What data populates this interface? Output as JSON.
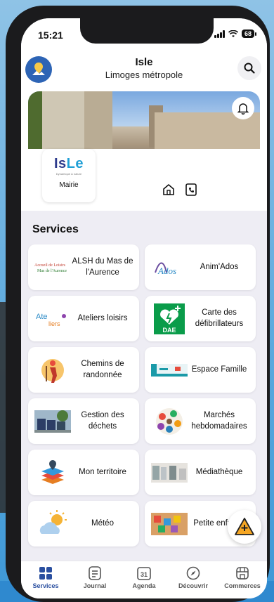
{
  "status_bar": {
    "time": "15:21",
    "battery": "68"
  },
  "header": {
    "title": "Isle",
    "subtitle": "Limoges métropole"
  },
  "mairie": {
    "logo_text_a": "Is",
    "logo_text_b": "Le",
    "tagline": "Dynamique & nature",
    "label": "Mairie"
  },
  "section_title": "Services",
  "services": [
    {
      "label": "ALSH du Mas de l'Aurence",
      "icon": "alsh-logo"
    },
    {
      "label": "Anim'Ados",
      "icon": "animados-logo"
    },
    {
      "label": "Ateliers loisirs",
      "icon": "ateliers-logo"
    },
    {
      "label": "Carte des défibrillateurs",
      "icon": "dae-logo"
    },
    {
      "label": "Chemins de randonnée",
      "icon": "hiker-icon"
    },
    {
      "label": "Espace Famille",
      "icon": "famille-screenshot"
    },
    {
      "label": "Gestion des déchets",
      "icon": "bins-photo"
    },
    {
      "label": "Marchés hebdomadaires",
      "icon": "market-icon"
    },
    {
      "label": "Mon territoire",
      "icon": "map-layers-icon"
    },
    {
      "label": "Médiathèque",
      "icon": "library-photo"
    },
    {
      "label": "Météo",
      "icon": "weather-icon"
    },
    {
      "label": "Petite enfance",
      "icon": "toys-photo"
    }
  ],
  "dae_text": "DAE",
  "tabs": [
    {
      "label": "Services",
      "icon": "grid-icon",
      "active": true
    },
    {
      "label": "Journal",
      "icon": "newspaper-icon"
    },
    {
      "label": "Agenda",
      "icon": "calendar-icon",
      "day": "31"
    },
    {
      "label": "Découvrir",
      "icon": "compass-icon"
    },
    {
      "label": "Commerces",
      "icon": "shop-icon"
    }
  ],
  "colors": {
    "accent": "#2a4fa0",
    "fab": "#f5a623",
    "dae_green": "#0a9c4a"
  }
}
